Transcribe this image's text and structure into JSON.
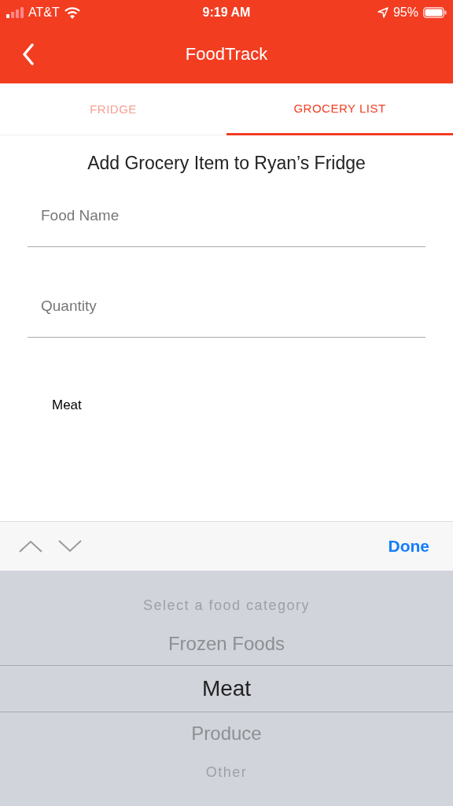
{
  "status_bar": {
    "carrier": "AT&T",
    "time": "9:19 AM",
    "battery": "95%"
  },
  "nav_bar": {
    "title": "FoodTrack"
  },
  "tabs": [
    {
      "label": "FRIDGE",
      "selected": false
    },
    {
      "label": "GROCERY LIST",
      "selected": true
    }
  ],
  "form": {
    "heading": "Add Grocery Item to Ryan’s Fridge",
    "fields": [
      {
        "placeholder": "Food Name"
      },
      {
        "placeholder": "Quantity"
      }
    ],
    "category_value": "Meat"
  },
  "keyboard_toolbar": {
    "done": "Done"
  },
  "picker": {
    "options": [
      {
        "label": "Select a food category",
        "selected": false
      },
      {
        "label": "Frozen Foods",
        "selected": false
      },
      {
        "label": "Meat",
        "selected": true
      },
      {
        "label": "Produce",
        "selected": false
      },
      {
        "label": "Other",
        "selected": false
      }
    ]
  }
}
